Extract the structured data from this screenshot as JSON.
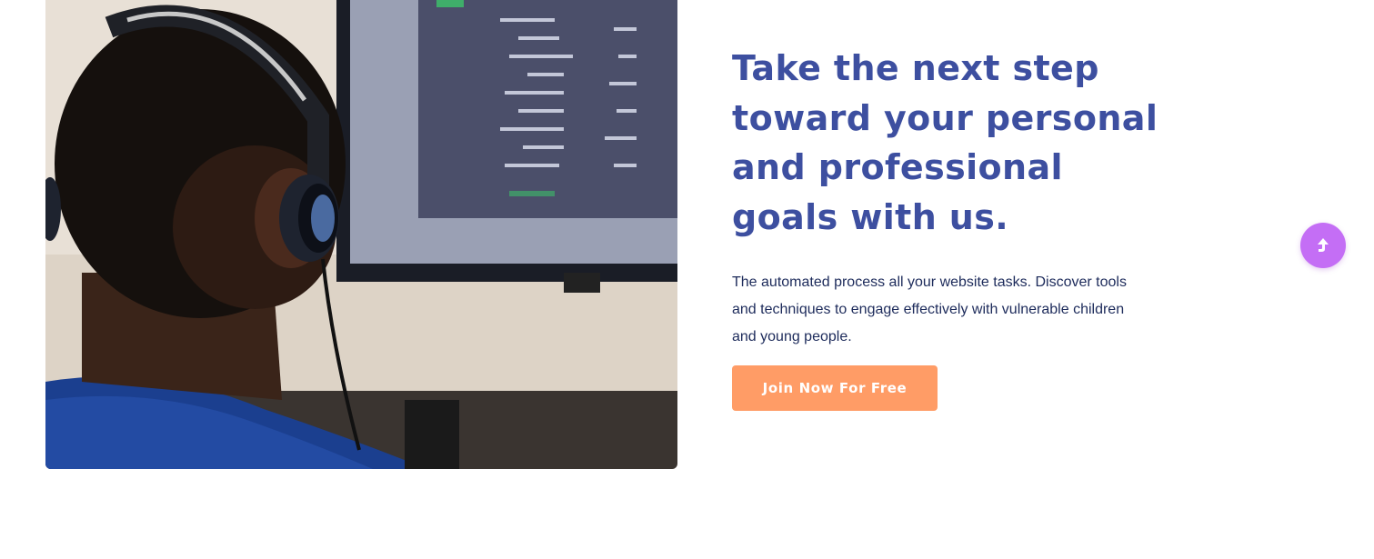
{
  "hero": {
    "image_alt": "Person wearing headphones looking at a computer monitor"
  },
  "content": {
    "headline": "Take the next step toward your personal and professional goals with us.",
    "description": "The automated process all your website tasks. Discover tools and techniques to engage effectively with vulnerable children and young people.",
    "cta_label": "Join Now For Free"
  },
  "scroll_top": {
    "icon": "arrow-up-icon"
  },
  "colors": {
    "headline": "#3d4fa0",
    "body_text": "#1d2b5b",
    "cta_background": "#ff9c66",
    "scroll_top_background": "#c46ef5"
  }
}
